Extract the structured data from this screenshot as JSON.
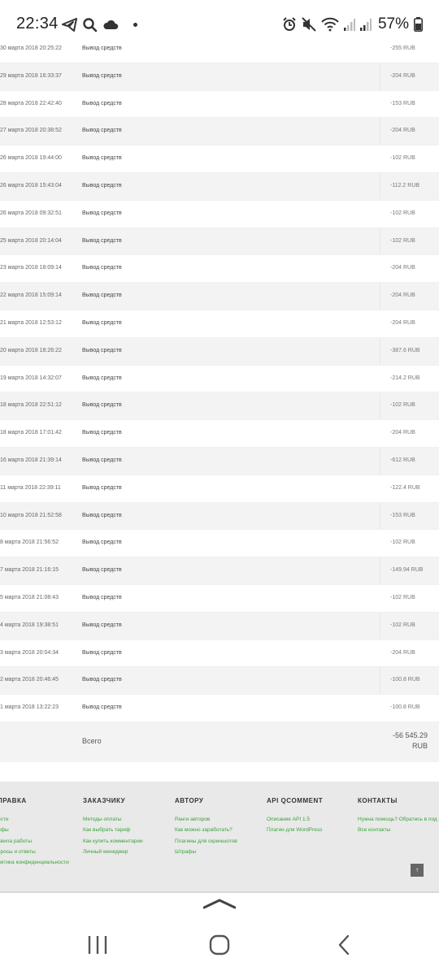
{
  "status_bar": {
    "time": "22:34",
    "battery_percent": "57%",
    "icons_left": [
      "telegram-icon",
      "search-icon",
      "cloud-icon",
      "dot-icon"
    ],
    "icons_right": [
      "alarm-icon",
      "mute-icon",
      "wifi-icon",
      "signal-icon",
      "signal-icon",
      "battery-icon"
    ]
  },
  "transactions": [
    {
      "date": "30 марта 2018 20:25:22",
      "operation": "Вывод средств",
      "amount": "-255 RUB"
    },
    {
      "date": "29 марта 2018 16:33:37",
      "operation": "Вывод средств",
      "amount": "-204 RUB"
    },
    {
      "date": "28 марта 2018 22:42:40",
      "operation": "Вывод средств",
      "amount": "-153 RUB"
    },
    {
      "date": "27 марта 2018 20:38:52",
      "operation": "Вывод средств",
      "amount": "-204 RUB"
    },
    {
      "date": "26 марта 2018 19:44:00",
      "operation": "Вывод средств",
      "amount": "-102 RUB"
    },
    {
      "date": "26 марта 2018 15:43:04",
      "operation": "Вывод средств",
      "amount": "-112.2 RUB"
    },
    {
      "date": "26 марта 2018 09:32:51",
      "operation": "Вывод средств",
      "amount": "-102 RUB"
    },
    {
      "date": "25 марта 2018 20:14:04",
      "operation": "Вывод средств",
      "amount": "-102 RUB"
    },
    {
      "date": "23 марта 2018 18:09:14",
      "operation": "Вывод средств",
      "amount": "-204 RUB"
    },
    {
      "date": "22 марта 2018 15:09:14",
      "operation": "Вывод средств",
      "amount": "-204 RUB"
    },
    {
      "date": "21 марта 2018 12:53:12",
      "operation": "Вывод средств",
      "amount": "-204 RUB"
    },
    {
      "date": "20 марта 2018 18:26:22",
      "operation": "Вывод средств",
      "amount": "-387.6 RUB"
    },
    {
      "date": "19 марта 2018 14:32:07",
      "operation": "Вывод средств",
      "amount": "-214.2 RUB"
    },
    {
      "date": "18 марта 2018 22:51:12",
      "operation": "Вывод средств",
      "amount": "-102 RUB"
    },
    {
      "date": "18 марта 2018 17:01:42",
      "operation": "Вывод средств",
      "amount": "-204 RUB"
    },
    {
      "date": "16 марта 2018 21:39:14",
      "operation": "Вывод средств",
      "amount": "-612 RUB"
    },
    {
      "date": "11 марта 2018 22:39:11",
      "operation": "Вывод средств",
      "amount": "-122.4 RUB"
    },
    {
      "date": "10 марта 2018 21:52:58",
      "operation": "Вывод средств",
      "amount": "-153 RUB"
    },
    {
      "date": "8 марта 2018 21:56:52",
      "operation": "Вывод средств",
      "amount": "-102 RUB"
    },
    {
      "date": "7 марта 2018 21:16:15",
      "operation": "Вывод средств",
      "amount": "-149.94 RUB"
    },
    {
      "date": "5 марта 2018 21:08:43",
      "operation": "Вывод средств",
      "amount": "-102 RUB"
    },
    {
      "date": "4 марта 2018 19:38:51",
      "operation": "Вывод средств",
      "amount": "-102 RUB"
    },
    {
      "date": "3 марта 2018 20:04:34",
      "operation": "Вывод средств",
      "amount": "-204 RUB"
    },
    {
      "date": "2 марта 2018 20:46:45",
      "operation": "Вывод средств",
      "amount": "-100.8 RUB"
    },
    {
      "date": "1 марта 2018 13:22:23",
      "operation": "Вывод средств",
      "amount": "-100.8 RUB"
    }
  ],
  "total": {
    "label": "Всего",
    "amount": "-56 545.29",
    "currency": "RUB"
  },
  "footer": {
    "columns": [
      {
        "title": "ПРАВКА",
        "links": [
          "ости",
          "ифы",
          "авила работы",
          "просы и ответы",
          "литика конфиденциальности"
        ]
      },
      {
        "title": "ЗАКАЗЧИКУ",
        "links": [
          "Методы оплаты",
          "Как выбрать тариф",
          "Как купить комментарии",
          "Личный менеджер"
        ]
      },
      {
        "title": "АВТОРУ",
        "links": [
          "Ранги авторов",
          "Как можно заработать?",
          "Плагины для скриншотов",
          "Штрафы"
        ]
      },
      {
        "title": "API QCOMMENT",
        "links": [
          "Описание API 1.5",
          "Плагин для WordPress"
        ]
      },
      {
        "title": "КОНТАКТЫ",
        "links": [
          "Нужна помощь? Обратись в под",
          "Все контакты"
        ]
      }
    ],
    "to_top_label": "↑"
  },
  "colors": {
    "link": "#3aa33a",
    "row_alt": "#f3f3f3",
    "footer_bg": "#e9e9e9"
  }
}
